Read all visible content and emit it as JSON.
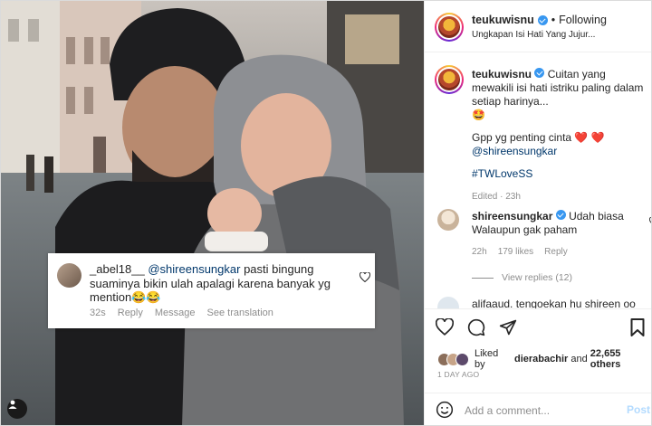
{
  "overlay_comment": {
    "username": "_abel18__",
    "mention": "@shireensungkar",
    "text": "pasti bingung suaminya bikin ulah apalagi karena banyak yg mention😂😂",
    "time": "32s",
    "reply": "Reply",
    "message": "Message",
    "see_translation": "See translation"
  },
  "header": {
    "username": "teukuwisnu",
    "separator": "•",
    "follow_status": "Following",
    "subtitle": "Ungkapan Isi Hati Yang Jujur..."
  },
  "caption": {
    "username": "teukuwisnu",
    "line1": "Cuitan yang mewakili isi hati istriku paling dalam setiap harinya...",
    "emoji1": "🤩",
    "line2": "Gpp yg penting cinta ❤️ ❤️",
    "mention": "@shireensungkar",
    "hashtag": "#TWLoveSS",
    "edited": "Edited · 23h"
  },
  "reply": {
    "username": "shireensungkar",
    "text": "Udah biasa Walaupun gak paham",
    "time": "22h",
    "likes": "179 likes",
    "reply": "Reply",
    "view_replies": "View replies (12)"
  },
  "cut_comment": "alifaaud. tengoekan hu shireen oo",
  "likes": {
    "prefix": "Liked by",
    "user": "dierabachir",
    "and": "and",
    "others": "22,655 others"
  },
  "ago": "1 DAY AGO",
  "comment_input": {
    "placeholder": "Add a comment...",
    "post": "Post"
  },
  "colors": {
    "verified": "#3897f0",
    "link": "#00376b",
    "heart": "#ed4956",
    "post_disabled": "#b3dbff"
  }
}
